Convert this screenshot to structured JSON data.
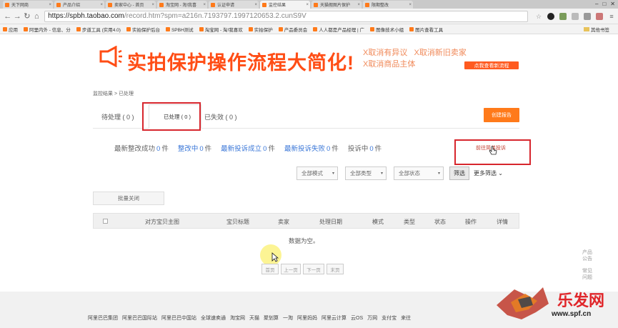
{
  "browser": {
    "tabs": [
      {
        "label": "天下网商",
        "active": false
      },
      {
        "label": "产品介绍",
        "active": false
      },
      {
        "label": "卖家中心 - 首页",
        "active": false
      },
      {
        "label": "淘宝网 - 淘!我喜",
        "active": false
      },
      {
        "label": "认证申请",
        "active": false
      },
      {
        "label": "监控结果",
        "active": true
      },
      {
        "label": "天猫假图片保护",
        "active": false
      },
      {
        "label": "限期整改",
        "active": false
      }
    ],
    "url_host": "https://spbh.taobao.com",
    "url_path": "/record.htm?spm=a216n.7193797.1997120653.2.cunS9V",
    "bookmarks": [
      "应用",
      "阿里内外 - 信息、分",
      "步道工具 (实用4.0)",
      "实拍保护后台",
      "SPBH测试",
      "淘宝网 - 淘!我喜欢",
      "实拍保护",
      "产品委员会",
      "人人都是产品经理 | 广",
      "图像技术小组",
      "图片查看工具"
    ],
    "other_bookmarks": "其他书签"
  },
  "banner": {
    "title": "实拍保护操作流程大简化!",
    "tips": [
      "X取消有异议",
      "X取消新旧卖家",
      "X取消商品主体",
      "X取消商品主体"
    ],
    "button": "点我查看新流程"
  },
  "breadcrumb": "监控结果 > 已处理",
  "tabs": {
    "pending": "待处理 ( 0 )",
    "processed": "已处理 ( 0 )",
    "invalid": "已失效 ( 0 )"
  },
  "create_report": "创建报告",
  "stats": [
    {
      "label": "最新整改成功",
      "num": "0",
      "unit": "件",
      "blue": false
    },
    {
      "label": "整改中",
      "num": "0",
      "unit": "件",
      "blue": true
    },
    {
      "label": "最新投诉成立",
      "num": "0",
      "unit": "件",
      "blue": true
    },
    {
      "label": "最新投诉失败",
      "num": "0",
      "unit": "件",
      "blue": true
    },
    {
      "label": "投诉中",
      "num": "0",
      "unit": "件",
      "blue": false
    }
  ],
  "goto_link": "前往简单投诉",
  "filters": {
    "mode": "全部模式",
    "type": "全部类型",
    "status": "全部状态",
    "filter_btn": "筛选",
    "more": "更多筛选"
  },
  "batch_close": "批量关闭",
  "table": {
    "columns": [
      "对方宝贝主图",
      "宝贝标题",
      "卖家",
      "处理日期",
      "模式",
      "类型",
      "状态",
      "操作",
      "详情"
    ],
    "empty": "数据为空。"
  },
  "pager": [
    "首页",
    "上一页",
    "下一页",
    "末页"
  ],
  "side_links": [
    "产品公告",
    "常见问题"
  ],
  "footer_links": [
    "阿里巴巴集团",
    "阿里巴巴国际站",
    "阿里巴巴中国站",
    "全球速卖通",
    "淘宝网",
    "天猫",
    "聚划算",
    "一淘",
    "阿里妈妈",
    "阿里云计算",
    "云OS",
    "万网",
    "支付宝",
    "来往"
  ],
  "watermark": {
    "text": "乐发网",
    "url": "www.spf.cn"
  },
  "colors": {
    "accent": "#ff7a1a",
    "red_frame": "#d7262d",
    "link": "#3c78d8"
  }
}
